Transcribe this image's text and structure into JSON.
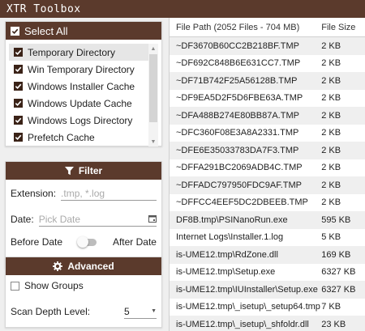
{
  "app": {
    "title": "XTR Toolbox"
  },
  "categories": {
    "select_all_label": "Select All",
    "items": [
      {
        "label": "Temporary Directory",
        "checked": true,
        "selected": true
      },
      {
        "label": "Win Temporary Directory",
        "checked": true,
        "selected": false
      },
      {
        "label": "Windows Installer Cache",
        "checked": true,
        "selected": false
      },
      {
        "label": "Windows Update Cache",
        "checked": true,
        "selected": false
      },
      {
        "label": "Windows Logs Directory",
        "checked": true,
        "selected": false
      },
      {
        "label": "Prefetch Cache",
        "checked": true,
        "selected": false
      }
    ]
  },
  "filter": {
    "title": "Filter",
    "extension_label": "Extension:",
    "extension_placeholder": ".tmp, *.log",
    "date_label": "Date:",
    "date_placeholder": "Pick Date",
    "before_label": "Before Date",
    "after_label": "After Date"
  },
  "advanced": {
    "title": "Advanced",
    "show_groups_label": "Show Groups",
    "scan_depth_label": "Scan Depth Level:",
    "scan_depth_value": "5"
  },
  "table": {
    "col_path": "File Path (2052 Files - 704 MB)",
    "col_size": "File Size",
    "rows": [
      {
        "path": "~DF3670B60CC2B218BF.TMP",
        "size": "2 KB"
      },
      {
        "path": "~DF692C848B6E631CC7.TMP",
        "size": "2 KB"
      },
      {
        "path": "~DF71B742F25A56128B.TMP",
        "size": "2 KB"
      },
      {
        "path": "~DF9EA5D2F5D6FBE63A.TMP",
        "size": "2 KB"
      },
      {
        "path": "~DFA488B274E80BB87A.TMP",
        "size": "2 KB"
      },
      {
        "path": "~DFC360F08E3A8A2331.TMP",
        "size": "2 KB"
      },
      {
        "path": "~DFE6E35033783DA7F3.TMP",
        "size": "2 KB"
      },
      {
        "path": "~DFFA291BC2069ADB4C.TMP",
        "size": "2 KB"
      },
      {
        "path": "~DFFADC797950FDC9AF.TMP",
        "size": "2 KB"
      },
      {
        "path": "~DFFCC4EEF5DC2DBEEB.TMP",
        "size": "2 KB"
      },
      {
        "path": "DF8B.tmp\\PSINanoRun.exe",
        "size": "595 KB"
      },
      {
        "path": "Internet Logs\\Installer.1.log",
        "size": "5 KB"
      },
      {
        "path": "is-UME12.tmp\\RdZone.dll",
        "size": "169 KB"
      },
      {
        "path": "is-UME12.tmp\\Setup.exe",
        "size": "6327 KB"
      },
      {
        "path": "is-UME12.tmp\\IUInstaller\\Setup.exe",
        "size": "6327 KB"
      },
      {
        "path": "is-UME12.tmp\\_isetup\\_setup64.tmp",
        "size": "7 KB"
      },
      {
        "path": "is-UME12.tmp\\_isetup\\_shfoldr.dll",
        "size": "23 KB"
      }
    ]
  }
}
